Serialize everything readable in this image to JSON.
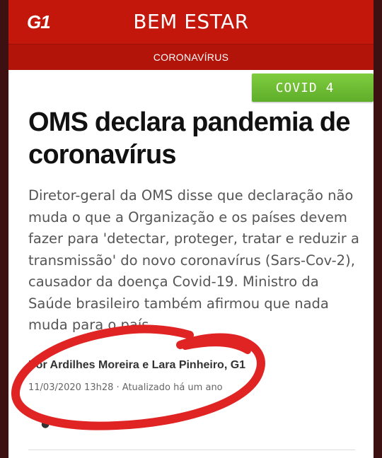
{
  "header": {
    "logo": "G1",
    "section": "BEM ESTAR"
  },
  "subheader": {
    "label": "CORONAVÍRUS"
  },
  "tag": {
    "label": "COVID 4",
    "color": "#6dbd32"
  },
  "article": {
    "headline": "OMS declara pandemia de coronavírus",
    "summary": "Diretor-geral da OMS disse que declaração não muda o que a Organização e os países devem fazer para 'detectar, proteger, tratar e reduzir a transmissão' do novo coronavírus (Sars-Cov-2), causador da doença Covid-19. Ministro da Saúde brasileiro também afirmou que nada muda para o país.",
    "byline": "Por Ardilhes Moreira e Lara Pinheiro, G1",
    "dateline": "11/03/2020 13h28 · Atualizado há um ano"
  },
  "colors": {
    "brand_red": "#c4170c",
    "annotation_red": "#e02424"
  }
}
